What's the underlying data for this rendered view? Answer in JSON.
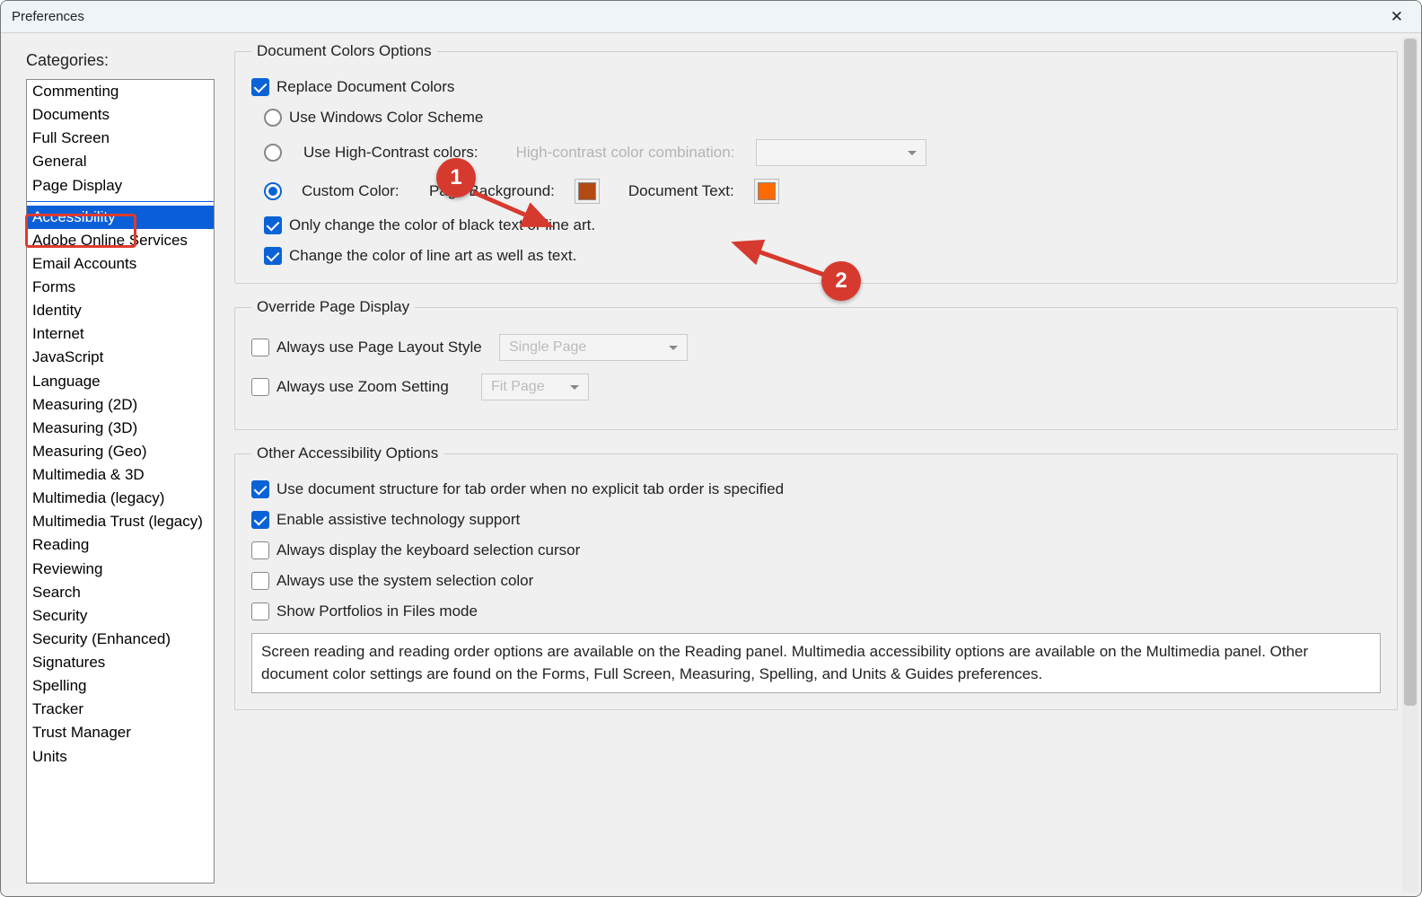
{
  "window": {
    "title": "Preferences"
  },
  "sidebar": {
    "label": "Categories:",
    "groups": [
      [
        "Commenting",
        "Documents",
        "Full Screen",
        "General",
        "Page Display"
      ],
      [
        "Accessibility",
        "Adobe Online Services",
        "Email Accounts",
        "Forms",
        "Identity",
        "Internet",
        "JavaScript",
        "Language",
        "Measuring (2D)",
        "Measuring (3D)",
        "Measuring (Geo)",
        "Multimedia & 3D",
        "Multimedia (legacy)",
        "Multimedia Trust (legacy)",
        "Reading",
        "Reviewing",
        "Search",
        "Security",
        "Security (Enhanced)",
        "Signatures",
        "Spelling",
        "Tracker",
        "Trust Manager",
        "Units"
      ]
    ],
    "selected": "Accessibility"
  },
  "docColors": {
    "legend": "Document Colors Options",
    "replace": {
      "label": "Replace Document Colors",
      "checked": true
    },
    "winScheme": {
      "label": "Use Windows Color Scheme",
      "selected": false
    },
    "highContrast": {
      "label": "Use High-Contrast colors:",
      "selected": false,
      "comboLabel": "High-contrast color combination:",
      "comboValue": ""
    },
    "custom": {
      "label": "Custom Color:",
      "selected": true,
      "bgLabel": "Page Background:",
      "bgColor": "#b34a14",
      "textLabel": "Document Text:",
      "textColor": "#ff6a00"
    },
    "onlyBlack": {
      "label": "Only change the color of black text or line art.",
      "checked": true
    },
    "lineArt": {
      "label": "Change the color of line art as well as text.",
      "checked": true
    }
  },
  "override": {
    "legend": "Override Page Display",
    "layout": {
      "label": "Always use Page Layout Style",
      "checked": false,
      "combo": "Single Page"
    },
    "zoom": {
      "label": "Always use Zoom Setting",
      "checked": false,
      "combo": "Fit Page"
    }
  },
  "other": {
    "legend": "Other Accessibility Options",
    "items": [
      {
        "label": "Use document structure for tab order when no explicit tab order is specified",
        "checked": true
      },
      {
        "label": "Enable assistive technology support",
        "checked": true
      },
      {
        "label": "Always display the keyboard selection cursor",
        "checked": false
      },
      {
        "label": "Always use the system selection color",
        "checked": false
      },
      {
        "label": "Show Portfolios in Files mode",
        "checked": false
      }
    ],
    "info": "Screen reading and reading order options are available on the Reading panel. Multimedia accessibility options are available on the Multimedia panel. Other document color settings are found on the Forms, Full Screen, Measuring, Spelling, and Units & Guides preferences."
  },
  "annotations": {
    "badge1": "1",
    "badge2": "2"
  }
}
